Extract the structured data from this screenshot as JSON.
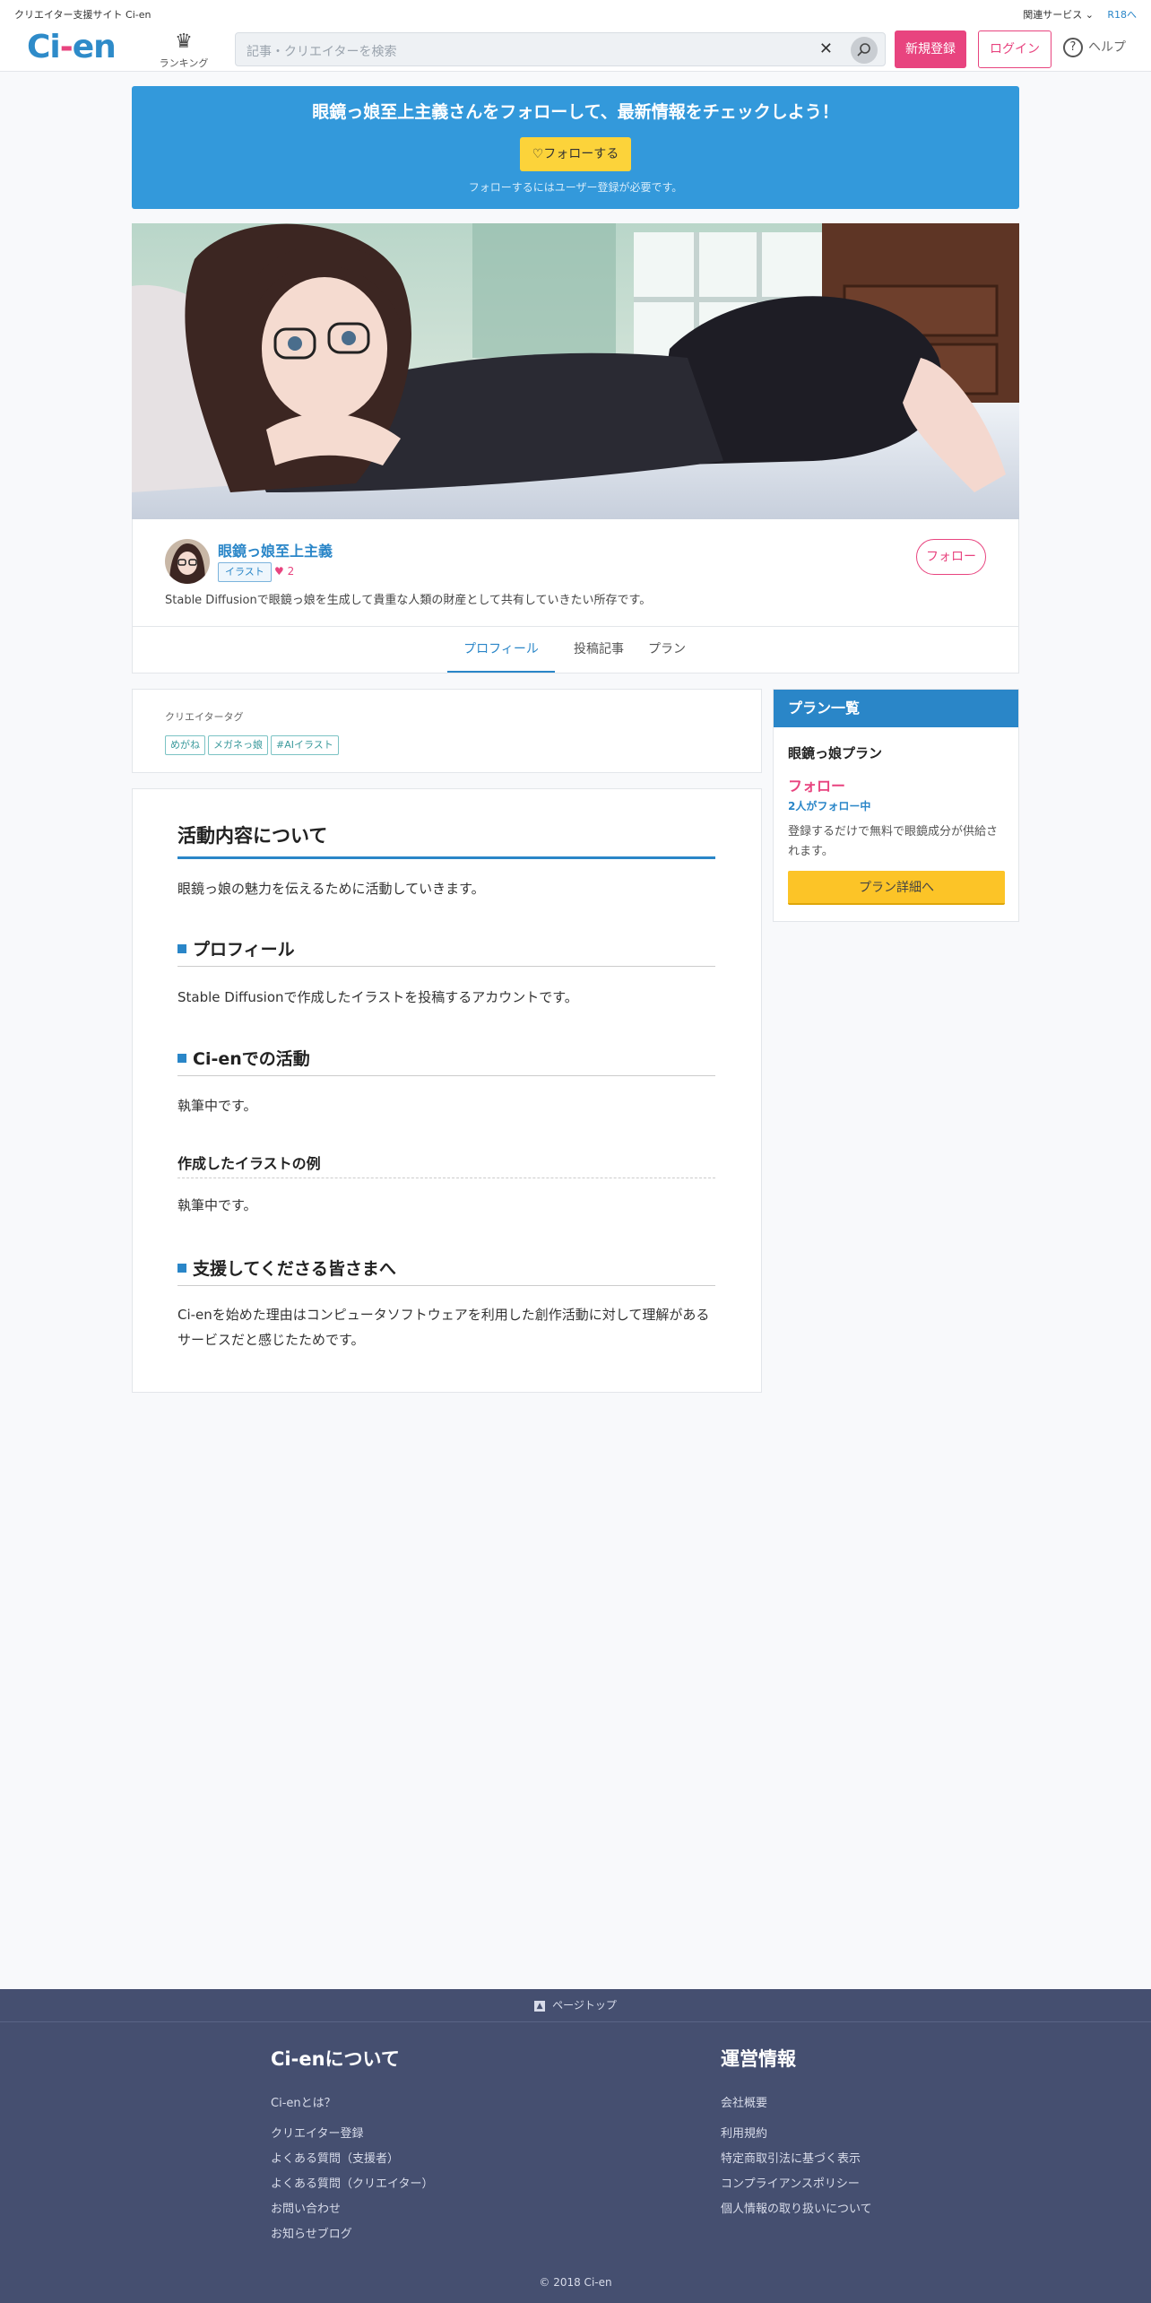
{
  "topbar": {
    "tagline": "クリエイター支援サイト Ci-en",
    "related": "関連サービス",
    "r18": "R18へ"
  },
  "header": {
    "logo_main": "Ci",
    "logo_dot": "-",
    "logo_tail": "en",
    "ranking_label": "ランキング",
    "search_placeholder": "記事・クリエイターを検索",
    "clear_glyph": "✕",
    "signup_label": "新規登録",
    "login_label": "ログイン",
    "help_label": "ヘルプ"
  },
  "banner": {
    "title": "眼鏡っ娘至上主義さんをフォローして、最新情報をチェックしよう！",
    "follow_button": "♡フォローする",
    "note": "フォローするにはユーザー登録が必要です。"
  },
  "creator": {
    "name": "眼鏡っ娘至上主義",
    "category": "イラスト",
    "likes": "2",
    "description": "Stable Diffusionで眼鏡っ娘を生成して貴重な人類の財産として共有していきたい所存です。",
    "follow_button": "フォロー"
  },
  "tabs": [
    {
      "label": "プロフィール",
      "active": true
    },
    {
      "label": "投稿記事",
      "active": false
    },
    {
      "label": "プラン",
      "active": false
    }
  ],
  "creator_tags": {
    "label": "クリエイタータグ",
    "tags": [
      "めがね",
      "メガネっ娘",
      "#AIイラスト"
    ]
  },
  "article": {
    "h2": "活動内容について",
    "intro": "眼鏡っ娘の魅力を伝えるために活動していきます。",
    "h3_profile": "プロフィール",
    "profile_text": "Stable Diffusionで作成したイラストを投稿するアカウントです。",
    "h3_activity": "Ci-enでの活動",
    "activity_text": "執筆中です。",
    "h4_examples": "作成したイラストの例",
    "examples_text": "執筆中です。",
    "h3_supporters": "支援してくださる皆さまへ",
    "supporters_text": "Ci-enを始めた理由はコンピュータソフトウェアを利用した創作活動に対して理解があるサービスだと感じたためです。"
  },
  "plan": {
    "header": "プラン一覧",
    "name": "眼鏡っ娘プラン",
    "price": "フォロー",
    "followers": "2人がフォロー中",
    "description": "登録するだけで無料で眼鏡成分が供給されます。",
    "button": "プラン詳細へ"
  },
  "footer": {
    "pagetop": "ページトップ",
    "about_title": "Ci-enについて",
    "about_links": [
      "Ci-enとは？",
      "クリエイター登録",
      "よくある質問（支援者）",
      "よくある質問（クリエイター）",
      "お問い合わせ",
      "お知らせブログ"
    ],
    "ops_title": "運営情報",
    "ops_links": [
      "会社概要",
      "利用規約",
      "特定商取引法に基づく表示",
      "コンプライアンスポリシー",
      "個人情報の取り扱いについて"
    ],
    "copyright": "© 2018 Ci-en"
  },
  "colors": {
    "brand_blue": "#2a86c8",
    "brand_pink": "#e8447f",
    "banner_blue": "#3399db",
    "yellow": "#fcd33a",
    "footer_bg": "#454f70"
  },
  "icons": {
    "ranking": "crown-icon",
    "search": "search-icon",
    "help": "help-icon",
    "heart": "heart-icon",
    "pagetop": "arrow-up-icon"
  }
}
